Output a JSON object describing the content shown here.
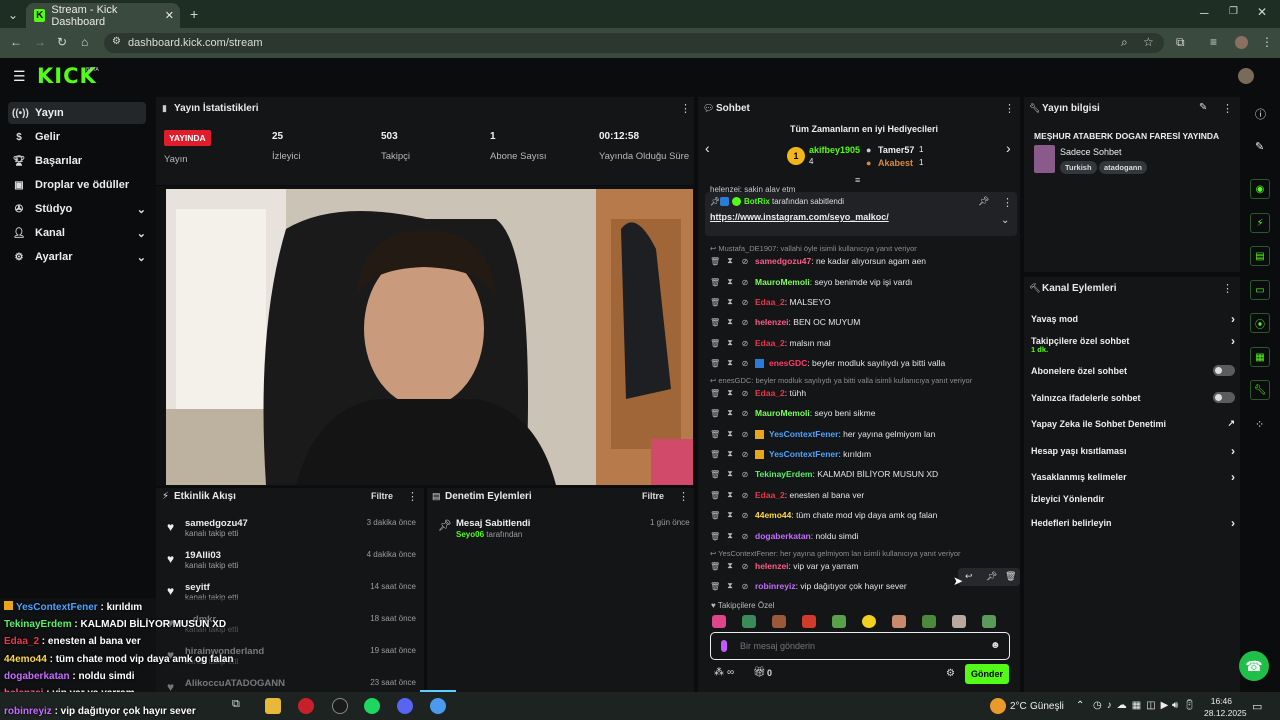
{
  "browser": {
    "tab_title": "Stream - Kick Dashboard",
    "url": "dashboard.kick.com/stream",
    "new_tab": "+"
  },
  "header": {
    "logo": "KICK",
    "logo_badge": "BETA"
  },
  "sidebar": {
    "items": [
      {
        "label": "Yayın",
        "icon": "broadcast-icon"
      },
      {
        "label": "Gelir",
        "icon": "dollar-icon"
      },
      {
        "label": "Başarılar",
        "icon": "trophy-icon"
      },
      {
        "label": "Droplar ve ödüller",
        "icon": "gift-icon"
      },
      {
        "label": "Stüdyo",
        "icon": "film-icon"
      },
      {
        "label": "Kanal",
        "icon": "user-icon"
      },
      {
        "label": "Ayarlar",
        "icon": "gear-icon"
      }
    ]
  },
  "stats": {
    "title": "Yayın İstatistikleri",
    "live_badge": "YAYINDA",
    "items": [
      {
        "value": "",
        "label": "Yayın"
      },
      {
        "value": "25",
        "label": "İzleyici"
      },
      {
        "value": "503",
        "label": "Takipçi"
      },
      {
        "value": "1",
        "label": "Abone Sayısı"
      },
      {
        "value": "00:12:58",
        "label": "Yayında Olduğu Süre"
      }
    ]
  },
  "activity": {
    "title": "Etkinlik Akışı",
    "filter": "Filtre",
    "items": [
      {
        "name": "samedgozu47",
        "sub": "kanalı takip etti",
        "time": "3 dakika önce"
      },
      {
        "name": "19Alli03",
        "sub": "kanalı takip etti",
        "time": "4 dakika önce"
      },
      {
        "name": "seyitf",
        "sub": "kanalı takip etti",
        "time": "14 saat önce"
      },
      {
        "name": "...dmkr",
        "sub": "kanalı takip etti",
        "time": "18 saat önce"
      },
      {
        "name": "hirainwonderland",
        "sub": "kanalı takip etti",
        "time": "19 saat önce"
      },
      {
        "name": "AlikoccuATADOGANN",
        "sub": "kanalı takip etti",
        "time": "23 saat önce"
      }
    ]
  },
  "moderation": {
    "title": "Denetim Eylemleri",
    "filter": "Filtre",
    "item": {
      "title": "Mesaj Sabitlendi",
      "user": "Seyo06",
      "suffix": "tarafından",
      "time": "1 gün önce"
    }
  },
  "chat": {
    "title": "Sohbet",
    "gifters_title": "Tüm Zamanların en iyi Hediyecileri",
    "gifters": [
      {
        "name": "akifbey1905",
        "count": "4"
      },
      {
        "name": "Tamer57",
        "count": "1"
      },
      {
        "name": "Akabest",
        "count": "1"
      }
    ],
    "pinned": {
      "by": "BotRix",
      "by_suffix": "tarafından sabitlendi",
      "link": "https://www.instagram.com/seyo_malkoc/",
      "partial": "helenzei: sakin alay etm"
    },
    "messages": [
      {
        "reply": "Mustafa_DE1907: vallahi öyle isimli kullanıcıya yanıt veriyor"
      },
      {
        "user": "samedgozu47",
        "text": ": ne kadar alıyorsun agam aen",
        "color": "#ff5b8a"
      },
      {
        "user": "MauroMemoli",
        "text": ": seyo benimde vip işi vardı",
        "color": "#7cff5a"
      },
      {
        "user": "Edaa_2",
        "text": ": MALSEYO",
        "color": "#e8394a"
      },
      {
        "user": "helenzei",
        "text": ": BEN OC MUYUM",
        "color": "#ff5b8a"
      },
      {
        "user": "Edaa_2",
        "text": ": malsın mal",
        "color": "#e8394a"
      },
      {
        "user": "enesGDC",
        "text": ": beyler modluk sayılıydı ya bitti valla",
        "color": "#ff3b6b"
      },
      {
        "reply": "enesGDC: beyler modluk sayılıydı ya bitti valla isimli kullanıcıya yanıt veriyor"
      },
      {
        "user": "Edaa_2",
        "text": ": tühh",
        "color": "#e8394a"
      },
      {
        "user": "MauroMemoli",
        "text": ": seyo beni sikme",
        "color": "#7cff5a"
      },
      {
        "user": "YesContextFener",
        "text": ": her yayına gelmiyom lan",
        "color": "#4da3ff"
      },
      {
        "user": "YesContextFener",
        "text": ": kırıldım",
        "color": "#4da3ff"
      },
      {
        "user": "TekinayErdem",
        "text": ": KALMADI BİLİYOR MUSUN XD",
        "color": "#5af06a"
      },
      {
        "user": "Edaa_2",
        "text": ": enesten al bana ver",
        "color": "#e8394a"
      },
      {
        "user": "44emo44",
        "text": ": tüm chate mod vip daya amk og falan",
        "color": "#ffd84a"
      },
      {
        "user": "dogaberkatan",
        "text": ": noldu simdi",
        "color": "#c56bff"
      },
      {
        "reply": "YesContextFener: her yayına gelmiyom lan isimli kullanıcıya yanıt veriyor"
      },
      {
        "user": "helenzei",
        "text": ": vip var ya yarram",
        "color": "#ff5b8a"
      },
      {
        "user": "robinreyiz",
        "text": ": vip dağıtıyor çok hayır sever",
        "color": "#c56bff"
      }
    ],
    "followers_only": "Takipçilere Özel",
    "input_placeholder": "Bir mesaj gönderin",
    "points": "∞",
    "gift_count": "0",
    "send": "Gönder"
  },
  "info": {
    "title": "Yayın bilgisi",
    "stream_title": "MEŞHUR ATABERK DOGAN FARESİ YAYINDA",
    "category": "Sadece Sohbet",
    "tags": [
      "Turkish",
      "atadogann"
    ]
  },
  "channel_actions": {
    "title": "Kanal Eylemleri",
    "rows": [
      {
        "label": "Yavaş mod",
        "type": "arrow"
      },
      {
        "label": "Takipçilere özel sohbet",
        "sub": "1 dk.",
        "type": "arrow"
      },
      {
        "label": "Abonelere özel sohbet",
        "type": "toggle"
      },
      {
        "label": "Yalnızca ifadelerle sohbet",
        "type": "toggle"
      },
      {
        "label": "Yapay Zeka ile Sohbet Denetimi",
        "type": "link"
      },
      {
        "label": "Hesap yaşı kısıtlaması",
        "type": "arrow"
      },
      {
        "label": "Yasaklanmış kelimeler",
        "type": "arrow"
      },
      {
        "label": "İzleyici Yönlendir",
        "type": "none"
      },
      {
        "label": "Hedefleri belirleyin",
        "type": "arrow"
      }
    ]
  },
  "overlay_chat": [
    {
      "user": "YesContextFener",
      "text": " : kırıldım",
      "color": "#4da3ff"
    },
    {
      "user": "TekinayErdem",
      "text": " : KALMADI BİLİYOR MUSUN XD",
      "color": "#5af06a"
    },
    {
      "user": "Edaa_2",
      "text": " : enesten al bana ver",
      "color": "#e8394a"
    },
    {
      "user": "44emo44",
      "text": " : tüm chate mod vip daya amk og falan",
      "color": "#ffd84a"
    },
    {
      "user": "dogaberkatan",
      "text": " : noldu simdi",
      "color": "#c56bff"
    },
    {
      "user": "helenzei",
      "text": " : vip var ya yarram",
      "color": "#ff5b8a"
    },
    {
      "user": "robinreyiz",
      "text": " : vip dağıtıyor çok hayır sever",
      "color": "#c56bff"
    }
  ],
  "taskbar": {
    "weather": "2°C",
    "weather_label": "Güneşli",
    "time": "16:46",
    "date": "28.12.2025"
  },
  "colors": {
    "accent": "#53fc18",
    "live": "#e11d2b"
  }
}
